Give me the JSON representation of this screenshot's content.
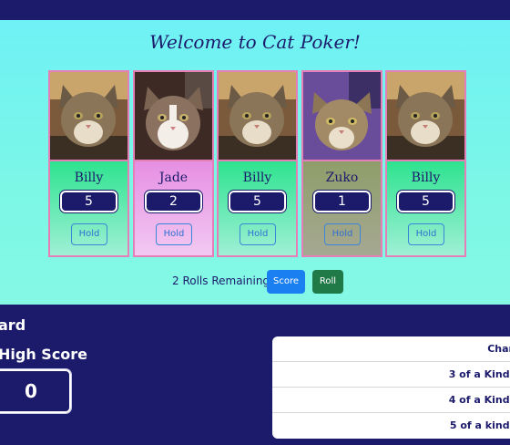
{
  "game": {
    "title": "Welcome to Cat Poker!",
    "cards": [
      {
        "name": "Billy",
        "value": "5",
        "hold_label": "Hold",
        "color": "green",
        "cat": "billy"
      },
      {
        "name": "Jade",
        "value": "2",
        "hold_label": "Hold",
        "color": "pink",
        "cat": "jade"
      },
      {
        "name": "Billy",
        "value": "5",
        "hold_label": "Hold",
        "color": "green",
        "cat": "billy"
      },
      {
        "name": "Zuko",
        "value": "1",
        "hold_label": "Hold",
        "color": "olive",
        "cat": "zuko"
      },
      {
        "name": "Billy",
        "value": "5",
        "hold_label": "Hold",
        "color": "green",
        "cat": "billy"
      }
    ],
    "rolls_remaining": "2 Rolls Remaining",
    "score_label": "Score",
    "roll_label": "Roll"
  },
  "scoreboard": {
    "heading_fragment": "ard",
    "high_score_label": "High Score",
    "high_score_value": "0"
  },
  "chart": {
    "rows": [
      "Char",
      "3 of a Kind:",
      "4 of a Kind:",
      "5 of a kind:"
    ]
  },
  "colors": {
    "navy": "#1c1a6b",
    "card_border": "#e47fb8",
    "score_button": "#1a7ff0",
    "roll_button": "#1f7a48"
  }
}
